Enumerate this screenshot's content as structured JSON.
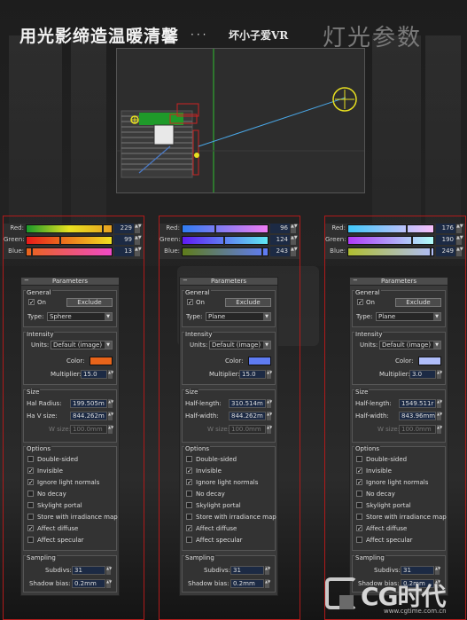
{
  "header": {
    "title": "用光影缔造温暖清馨",
    "dots": "···",
    "author": "坏小子爱VR",
    "section_title": "灯光参数"
  },
  "columns": [
    {
      "rgb": {
        "red_label": "Red:",
        "green_label": "Green:",
        "blue_label": "Blue:",
        "red": "229",
        "green": "99",
        "blue": "13",
        "red_marker": 0.9,
        "green_marker": 0.39,
        "blue_marker": 0.05
      },
      "params": {
        "rollout": "Parameters",
        "general": "General",
        "on_label": "On",
        "exclude": "Exclude",
        "type_label": "Type:",
        "type_value": "Sphere",
        "intensity": "Intensity",
        "units_label": "Units:",
        "units_value": "Default (image)",
        "color_label": "Color:",
        "color": "#e8641a",
        "multiplier_label": "Multiplier:",
        "multiplier": "15.0",
        "size": "Size",
        "size1_label": "Hal Radius:",
        "size1": "199.505m",
        "size2_label": "Ha V size:",
        "size2": "844.262m",
        "size3_label": "W size:",
        "size3": "100.0mm",
        "options": "Options",
        "opt_double": "Double-sided",
        "opt_invisible": "Invisible",
        "opt_ignore": "Ignore light normals",
        "opt_nodecay": "No decay",
        "opt_skylight": "Skylight portal",
        "opt_store": "Store with irradiance map",
        "opt_diffuse": "Affect diffuse",
        "opt_specular": "Affect specular",
        "sampling": "Sampling",
        "subdivs_label": "Subdivs:",
        "subdivs": "31",
        "shadow_label": "Shadow bias:",
        "shadow": "0.2mm"
      }
    },
    {
      "rgb": {
        "red_label": "Red:",
        "green_label": "Green:",
        "blue_label": "Blue:",
        "red": "96",
        "green": "124",
        "blue": "243",
        "red_marker": 0.38,
        "green_marker": 0.49,
        "blue_marker": 0.95
      },
      "params": {
        "rollout": "Parameters",
        "general": "General",
        "on_label": "On",
        "exclude": "Exclude",
        "type_label": "Type:",
        "type_value": "Plane",
        "intensity": "Intensity",
        "units_label": "Units:",
        "units_value": "Default (image)",
        "color_label": "Color:",
        "color": "#5f7cf2",
        "multiplier_label": "Multiplier:",
        "multiplier": "15.0",
        "size": "Size",
        "size1_label": "Half-length:",
        "size1": "310.514m",
        "size2_label": "Half-width:",
        "size2": "844.262m",
        "size3_label": "W size:",
        "size3": "100.0mm",
        "options": "Options",
        "opt_double": "Double-sided",
        "opt_invisible": "Invisible",
        "opt_ignore": "Ignore light normals",
        "opt_nodecay": "No decay",
        "opt_skylight": "Skylight portal",
        "opt_store": "Store with irradiance map",
        "opt_diffuse": "Affect diffuse",
        "opt_specular": "Affect specular",
        "sampling": "Sampling",
        "subdivs_label": "Subdivs:",
        "subdivs": "31",
        "shadow_label": "Shadow bias:",
        "shadow": "0.2mm"
      }
    },
    {
      "rgb": {
        "red_label": "Red:",
        "green_label": "Green:",
        "blue_label": "Blue:",
        "red": "176",
        "green": "190",
        "blue": "249",
        "red_marker": 0.69,
        "green_marker": 0.75,
        "blue_marker": 0.98
      },
      "params": {
        "rollout": "Parameters",
        "general": "General",
        "on_label": "On",
        "exclude": "Exclude",
        "type_label": "Type:",
        "type_value": "Plane",
        "intensity": "Intensity",
        "units_label": "Units:",
        "units_value": "Default (image)",
        "color_label": "Color:",
        "color": "#b0befa",
        "multiplier_label": "Multiplier:",
        "multiplier": "3.0",
        "size": "Size",
        "size1_label": "Half-length:",
        "size1": "1549.511r",
        "size2_label": "Half-width:",
        "size2": "843.96mm",
        "size3_label": "W size:",
        "size3": "100.0mm",
        "options": "Options",
        "opt_double": "Double-sided",
        "opt_invisible": "Invisible",
        "opt_ignore": "Ignore light normals",
        "opt_nodecay": "No decay",
        "opt_skylight": "Skylight portal",
        "opt_store": "Store with irradiance map",
        "opt_diffuse": "Affect diffuse",
        "opt_specular": "Affect specular",
        "sampling": "Sampling",
        "subdivs_label": "Subdivs:",
        "subdivs": "31",
        "shadow_label": "Shadow bias:",
        "shadow": "0.2mm"
      }
    }
  ],
  "watermark": {
    "brand": "CG时代",
    "url": "www.cgtime.com.cn"
  },
  "gradients": {
    "col1_red": "linear-gradient(90deg,#1a9a2a,#e8e220,#e8a020)",
    "col1_green": "linear-gradient(90deg,#e81a1a,#f0e020)",
    "col1_blue": "linear-gradient(90deg,#e8641a,#f04ac8)",
    "col2_red": "linear-gradient(90deg,#2f7cf2,#f07cf2)",
    "col2_green": "linear-gradient(90deg,#5f1af2,#5fe8f2)",
    "col2_blue": "linear-gradient(90deg,#5f7c1a,#5f7cf8)",
    "col3_red": "linear-gradient(90deg,#40c8fa,#f8befa)",
    "col3_green": "linear-gradient(90deg,#b03af8,#b0fef8)",
    "col3_blue": "linear-gradient(90deg,#b0be30,#b0befa)"
  }
}
